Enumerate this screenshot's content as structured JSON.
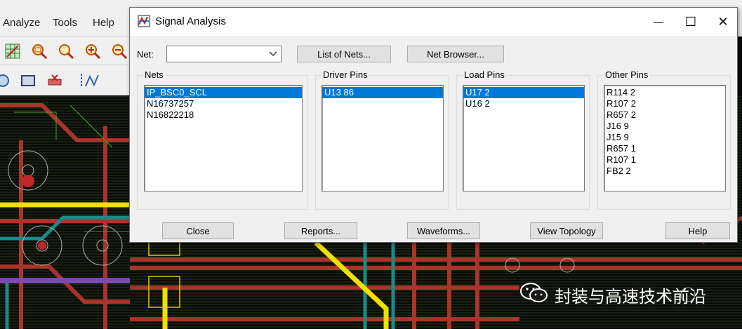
{
  "background_app": {
    "menu": [
      "Analyze",
      "Tools",
      "Help"
    ],
    "toolbar_icons": [
      "grid-icon",
      "zoom-fit-icon",
      "zoom-icon",
      "zoom-in-icon",
      "zoom-out-icon",
      "circle-icon",
      "rectangle-icon",
      "delete-icon",
      "route-icon"
    ]
  },
  "watermark": {
    "text": "封装与高速技术前沿",
    "icon": "wechat-icon"
  },
  "dialog": {
    "title": "Signal Analysis",
    "controls": {
      "minimize": "—",
      "maximize": "☐",
      "close": "✕"
    },
    "net_label": "Net:",
    "net_value": "",
    "list_of_nets_button": "List of Nets...",
    "net_browser_button": "Net Browser...",
    "groups": {
      "nets": {
        "label": "Nets",
        "items": [
          "IP_BSC0_SCL",
          "N16737257",
          "N16822218"
        ],
        "selected": 0
      },
      "driver_pins": {
        "label": "Driver Pins",
        "items": [
          "U13 86"
        ],
        "selected": 0
      },
      "load_pins": {
        "label": "Load Pins",
        "items": [
          "U17 2",
          "U16 2"
        ],
        "selected": 0
      },
      "other_pins": {
        "label": "Other Pins",
        "items": [
          "R114 2",
          "R107 2",
          "R657 2",
          "J16 9",
          "J15 9",
          "R657 1",
          "R107 1",
          "FB2 2"
        ],
        "selected": -1
      }
    },
    "buttons": {
      "close": "Close",
      "reports": "Reports...",
      "waveforms": "Waveforms...",
      "view_topology": "View Topology",
      "help": "Help"
    }
  }
}
